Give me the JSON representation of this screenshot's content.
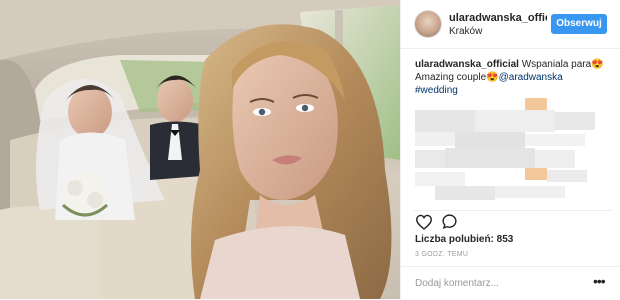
{
  "post": {
    "photo_alt": "Wedding selfie in a car",
    "header": {
      "username": "ularadwanska_offic",
      "location": "Kraków",
      "follow_label": "Obserwuj"
    },
    "caption": {
      "username": "ularadwanska_official",
      "text1": "Wspaniala para",
      "emoji1": "😍",
      "text2": "Amazing couple",
      "emoji2": "😍",
      "mention": "@aradwanska",
      "hashtag": "#wedding"
    },
    "likes": "Liczba polubień: 853",
    "time": "3 GODZ. TEMU",
    "comment_placeholder": "Dodaj komentarz...",
    "more_icon": "ellipsis-icon"
  },
  "colors": {
    "accent": "#3897f0",
    "link": "#003569",
    "text": "#262626",
    "muted": "#999999"
  }
}
